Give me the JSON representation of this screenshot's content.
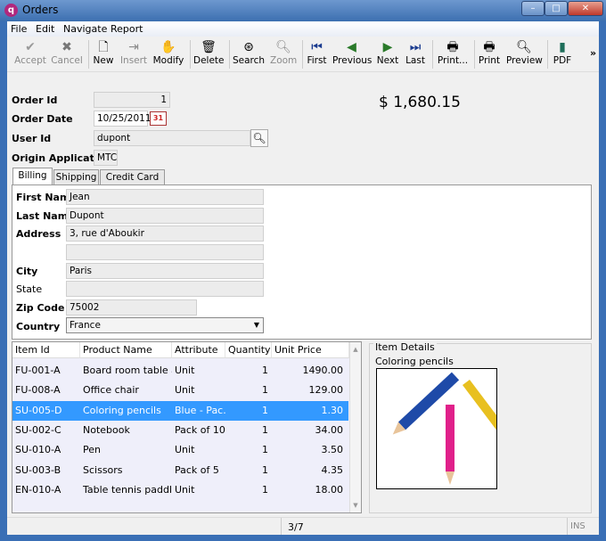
{
  "window": {
    "title": "Orders",
    "icon": "q-app-icon",
    "controls": [
      "minimize",
      "maximize",
      "close"
    ]
  },
  "menu": [
    "File",
    "Edit",
    "Navigate",
    "Report"
  ],
  "toolbar": [
    {
      "label": "Accept",
      "icon": "check-icon",
      "enabled": false
    },
    {
      "label": "Cancel",
      "icon": "x-icon",
      "enabled": false
    },
    {
      "label": "New",
      "icon": "new-document-icon",
      "enabled": true
    },
    {
      "label": "Insert",
      "icon": "insert-icon",
      "enabled": false
    },
    {
      "label": "Modify",
      "icon": "hand-icon",
      "enabled": true
    },
    {
      "label": "Delete",
      "icon": "trash-icon",
      "enabled": true
    },
    {
      "label": "Search",
      "icon": "binoculars-icon",
      "enabled": true
    },
    {
      "label": "Zoom",
      "icon": "magnifier-icon",
      "enabled": false
    },
    {
      "label": "First",
      "icon": "first-icon",
      "enabled": true
    },
    {
      "label": "Previous",
      "icon": "previous-icon",
      "enabled": true
    },
    {
      "label": "Next",
      "icon": "next-icon",
      "enabled": true
    },
    {
      "label": "Last",
      "icon": "last-icon",
      "enabled": true
    },
    {
      "label": "Print...",
      "icon": "printer-icon",
      "enabled": true
    },
    {
      "label": "Print",
      "icon": "printer-icon",
      "enabled": true
    },
    {
      "label": "Preview",
      "icon": "magnifier-icon",
      "enabled": true
    },
    {
      "label": "PDF",
      "icon": "pdf-icon",
      "enabled": true
    }
  ],
  "overflow": "»",
  "order": {
    "id_label": "Order Id",
    "id": "1",
    "date_label": "Order Date",
    "date": "10/25/2011",
    "user_label": "User Id",
    "user": "dupont",
    "origin_label": "Origin Application",
    "origin": "MTC",
    "total": "$  1,680.15"
  },
  "tabs": [
    "Billing",
    "Shipping",
    "Credit Card"
  ],
  "billing": {
    "first_name_label": "First Name",
    "first_name": "Jean",
    "last_name_label": "Last Name",
    "last_name": "Dupont",
    "address_label": "Address",
    "address1": "3, rue d'Aboukir",
    "address2": "",
    "city_label": "City",
    "city": "Paris",
    "state_label": "State",
    "state": "",
    "zip_label": "Zip Code",
    "zip": "75002",
    "country_label": "Country",
    "country": "France"
  },
  "items": {
    "columns": [
      "Item Id",
      "Product Name",
      "Attribute",
      "Quantity",
      "Unit Price"
    ],
    "rows": [
      [
        "FU-001-A",
        "Board room table an...",
        "Unit",
        "1",
        "1490.00"
      ],
      [
        "FU-008-A",
        "Office chair",
        "Unit",
        "1",
        "129.00"
      ],
      [
        "SU-005-D",
        "Coloring pencils",
        "Blue - Pac...",
        "1",
        "1.30"
      ],
      [
        "SU-002-C",
        "Notebook",
        "Pack of 10",
        "1",
        "34.00"
      ],
      [
        "SU-010-A",
        "Pen",
        "Unit",
        "1",
        "3.50"
      ],
      [
        "SU-003-B",
        "Scissors",
        "Pack of 5",
        "1",
        "4.35"
      ],
      [
        "EN-010-A",
        "Table tennis paddles...",
        "Unit",
        "1",
        "18.00"
      ]
    ],
    "selected": 2
  },
  "details": {
    "title": "Item Details",
    "name": "Coloring pencils"
  },
  "status": {
    "record": "3/7",
    "mode": "INS"
  }
}
